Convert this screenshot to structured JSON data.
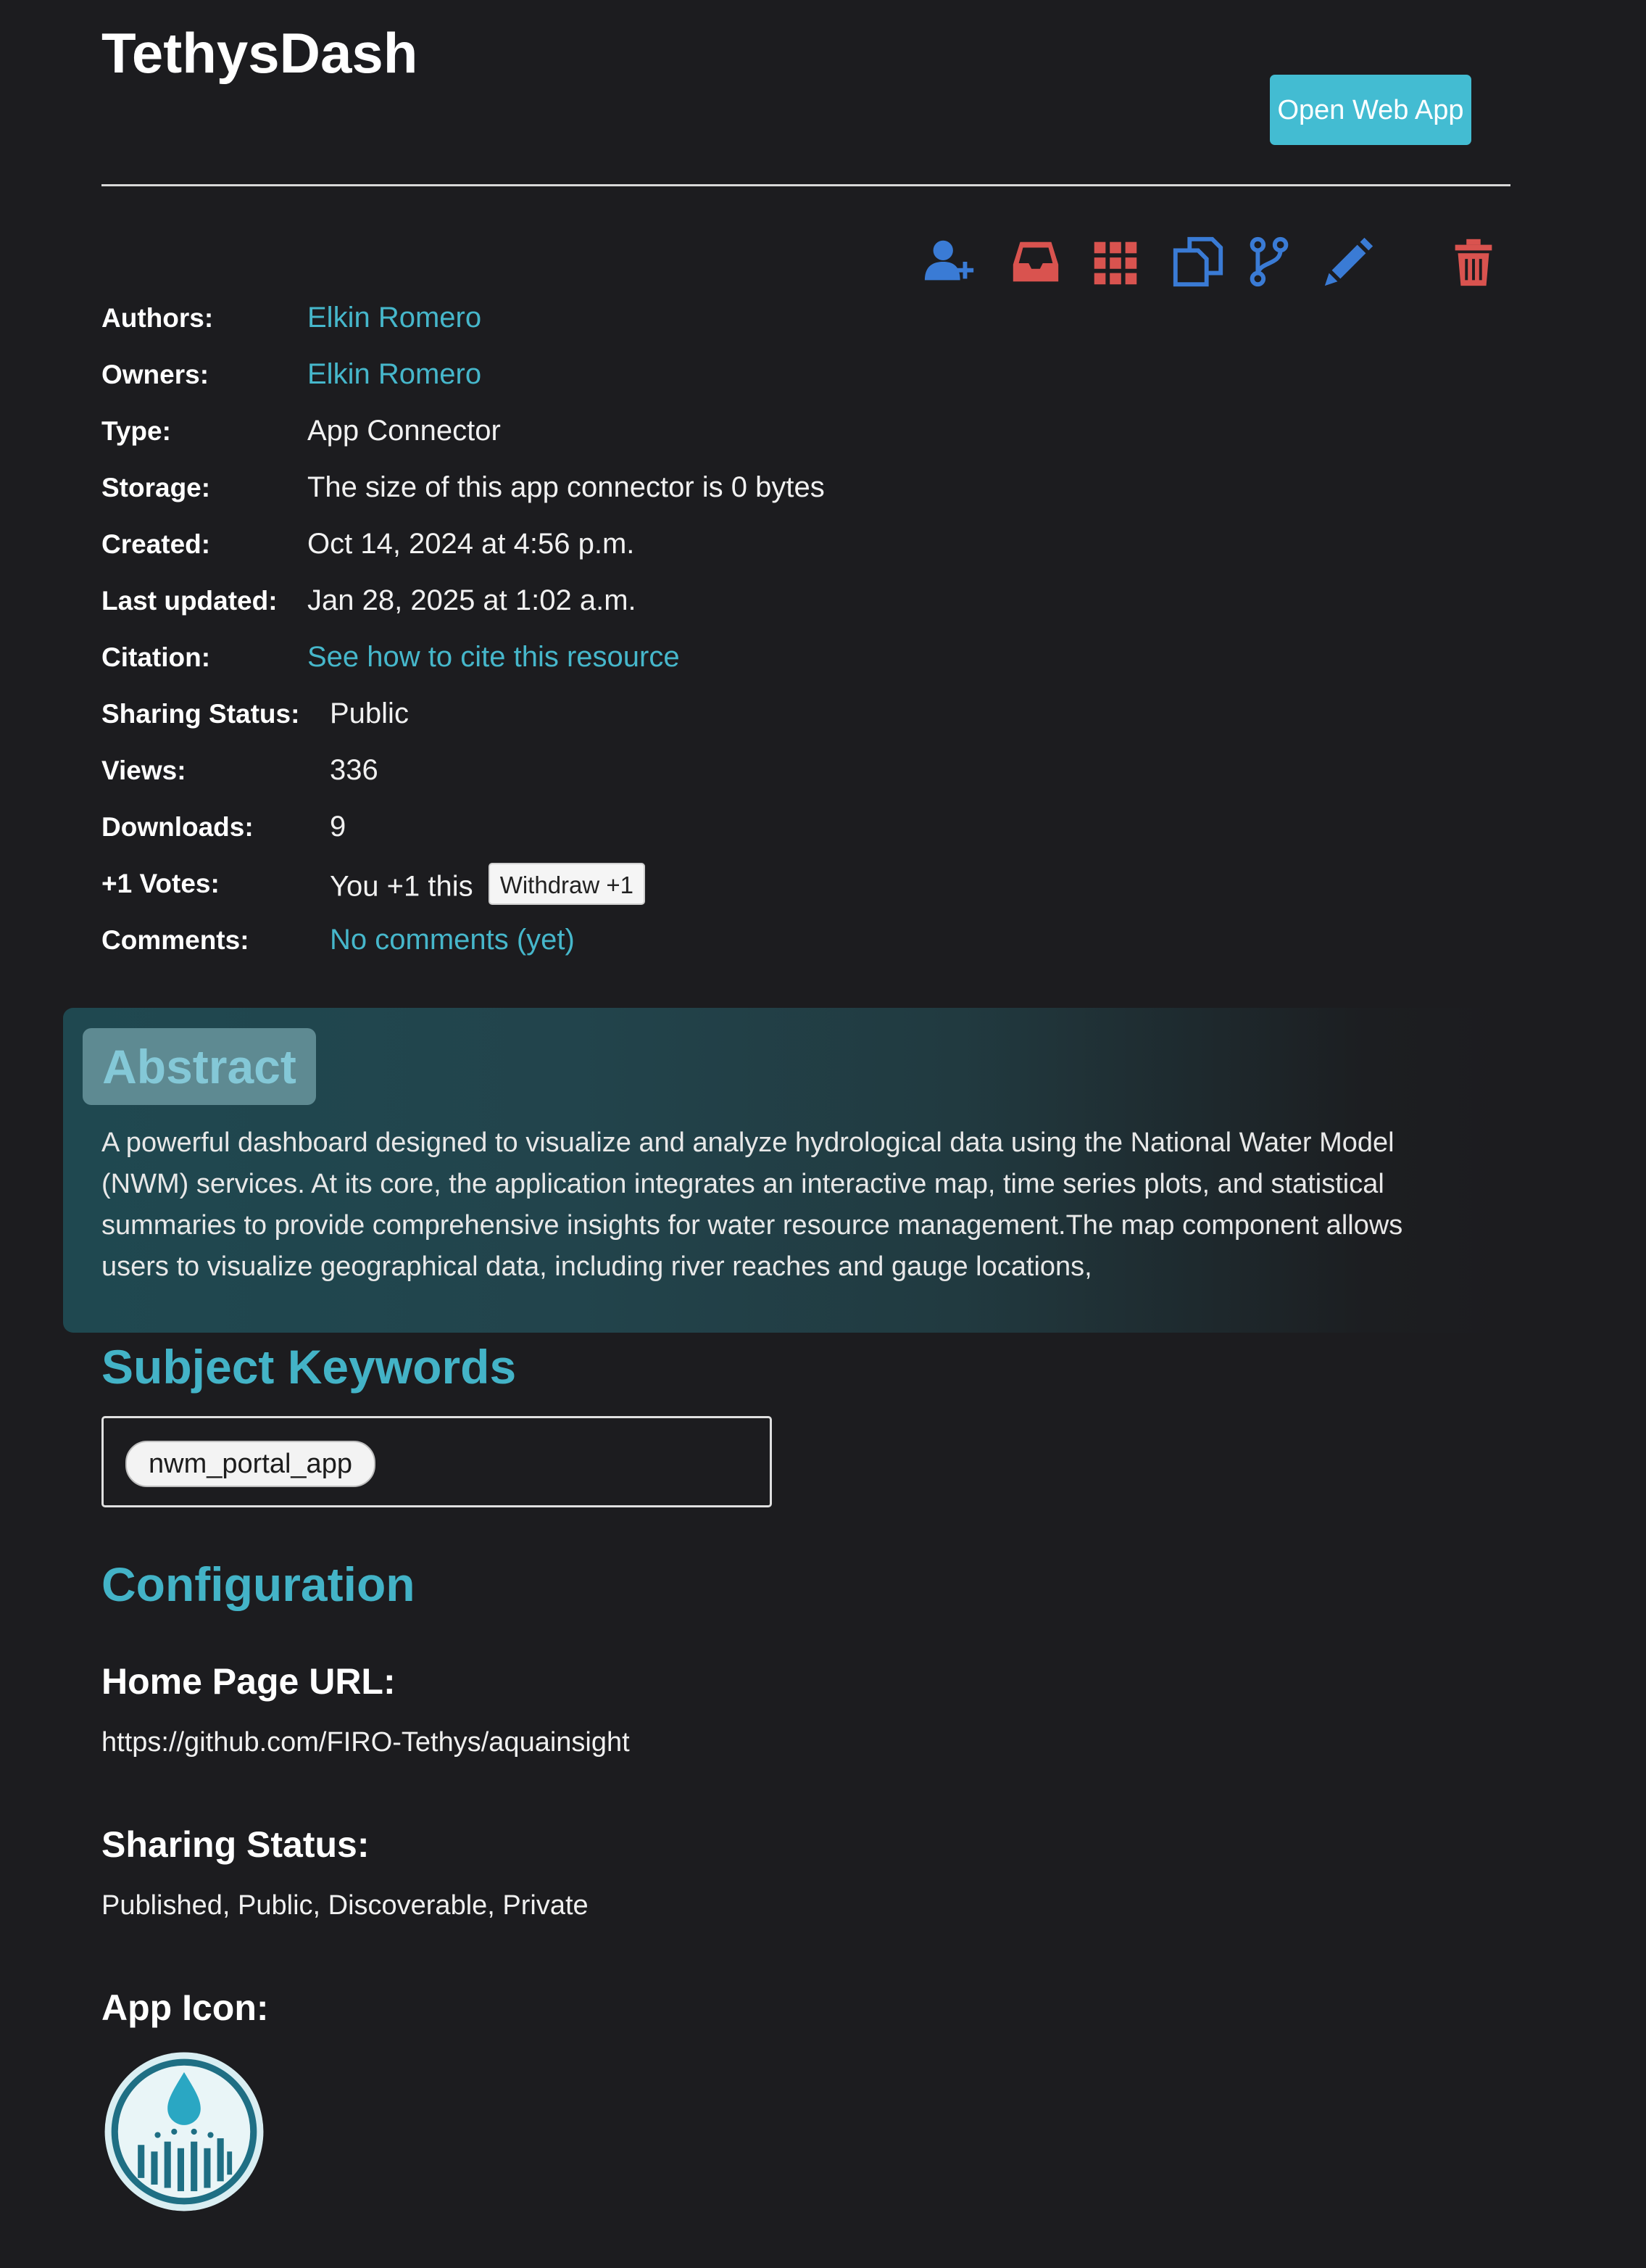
{
  "title": "TethysDash",
  "open_button": "Open Web App",
  "toolbar": {
    "icons": [
      "add-user-icon",
      "inbox-icon",
      "grid-icon",
      "copy-icon",
      "fork-icon",
      "edit-icon",
      "trash-icon"
    ]
  },
  "meta": {
    "authors": {
      "label": "Authors:",
      "value": "Elkin Romero"
    },
    "owners": {
      "label": "Owners:",
      "value": "Elkin Romero"
    },
    "type": {
      "label": "Type:",
      "value": "App Connector"
    },
    "storage": {
      "label": "Storage:",
      "value": "The size of this app connector is 0 bytes"
    },
    "created": {
      "label": "Created:",
      "value": "Oct 14, 2024 at 4:56 p.m."
    },
    "updated": {
      "label": "Last updated:",
      "value": "Jan 28, 2025 at 1:02 a.m."
    },
    "citation": {
      "label": "Citation:",
      "value": "See how to cite this resource"
    },
    "sharing": {
      "label": "Sharing Status:",
      "value": "Public"
    },
    "views": {
      "label": "Views:",
      "value": "336"
    },
    "downloads": {
      "label": "Downloads:",
      "value": "9"
    },
    "votes": {
      "label": "+1 Votes:",
      "value": "You +1 this",
      "button": "Withdraw +1"
    },
    "comments": {
      "label": "Comments:",
      "value": "No comments (yet)"
    }
  },
  "abstract": {
    "label": "Abstract",
    "text": "A powerful dashboard designed to visualize and analyze hydrological data using the National Water Model (NWM) services. At its core, the application integrates an interactive map, time series plots, and statistical summaries to provide comprehensive insights for water resource management.The map component allows users to visualize geographical data, including river reaches and gauge locations,"
  },
  "keywords": {
    "heading": "Subject Keywords",
    "items": [
      "nwm_portal_app"
    ]
  },
  "configuration": {
    "heading": "Configuration",
    "home_page_label": "Home Page URL:",
    "home_page_value": "https://github.com/FIRO-Tethys/aquainsight",
    "sharing_label": "Sharing Status:",
    "sharing_value": "Published, Public, Discoverable, Private",
    "app_icon_label": "App Icon:"
  },
  "colors": {
    "accent": "#43bcd2",
    "link": "#46b7cb",
    "icon_blue": "#3a7bd5",
    "icon_red": "#d9534f"
  }
}
